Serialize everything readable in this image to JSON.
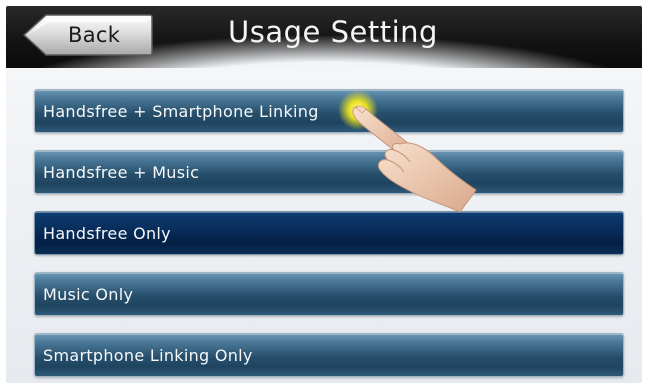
{
  "header": {
    "back_label": "Back",
    "title": "Usage Setting"
  },
  "options": [
    {
      "label": "Handsfree + Smartphone Linking",
      "selected": false
    },
    {
      "label": "Handsfree + Music",
      "selected": false
    },
    {
      "label": "Handsfree Only",
      "selected": true
    },
    {
      "label": "Music Only",
      "selected": false
    },
    {
      "label": "Smartphone Linking Only",
      "selected": false
    }
  ],
  "colors": {
    "header_bg": "#141414",
    "option_bg": "#264f6b",
    "option_selected_bg": "#082e5c",
    "touch_highlight": "#e8e020"
  },
  "icons": {
    "back": "back-arrow-button-shape",
    "pointer": "pointing-hand-icon"
  }
}
